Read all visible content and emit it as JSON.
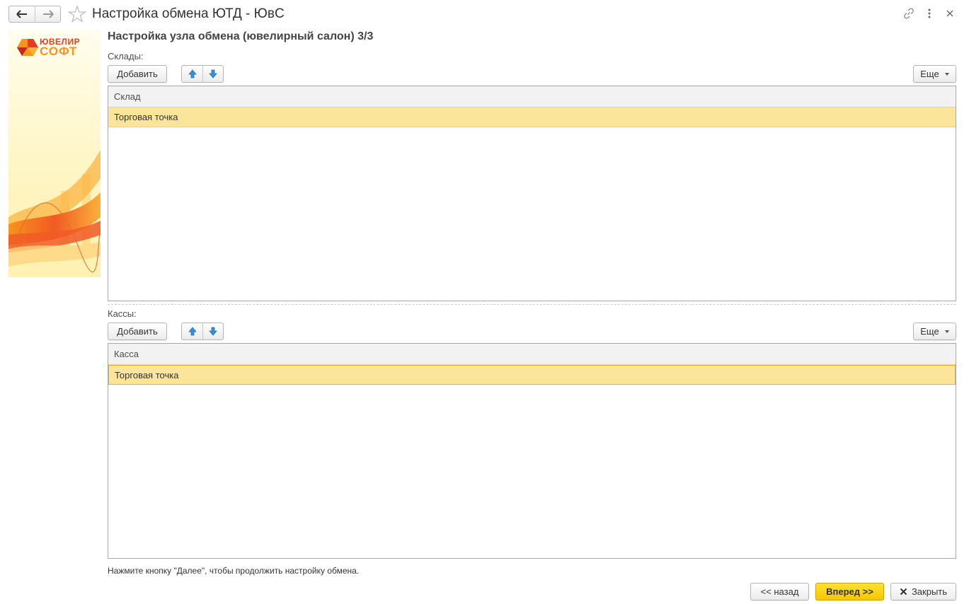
{
  "window": {
    "title": "Настройка обмена ЮТД - ЮвС",
    "nav_back_icon": "arrow-left-icon",
    "nav_forward_icon": "arrow-right-icon",
    "favorite_icon": "star-icon",
    "link_icon": "link-icon",
    "more_icon": "vertical-dots-icon",
    "close_icon": "close-icon"
  },
  "logo": {
    "line1": "ЮВЕЛИР",
    "line2": "СОФТ",
    "brand_color": "#e53e1e"
  },
  "page": {
    "heading": "Настройка узла обмена (ювелирный салон) 3/3",
    "hint": "Нажмите кнопку \"Далее\", чтобы продолжить настройку обмена."
  },
  "warehouses": {
    "label": "Склады:",
    "add_label": "Добавить",
    "more_label": "Еще",
    "column_header": "Склад",
    "rows": [
      "Торговая точка"
    ]
  },
  "cashboxes": {
    "label": "Кассы:",
    "add_label": "Добавить",
    "more_label": "Еще",
    "column_header": "Касса",
    "rows": [
      "Торговая точка"
    ]
  },
  "footer": {
    "back_label": "<< назад",
    "next_label": "Вперед >>",
    "close_label": "Закрыть"
  },
  "colors": {
    "selected_row": "#fbe59b",
    "primary_button": "#f5c800",
    "arrow_icon": "#3a8fd6"
  }
}
